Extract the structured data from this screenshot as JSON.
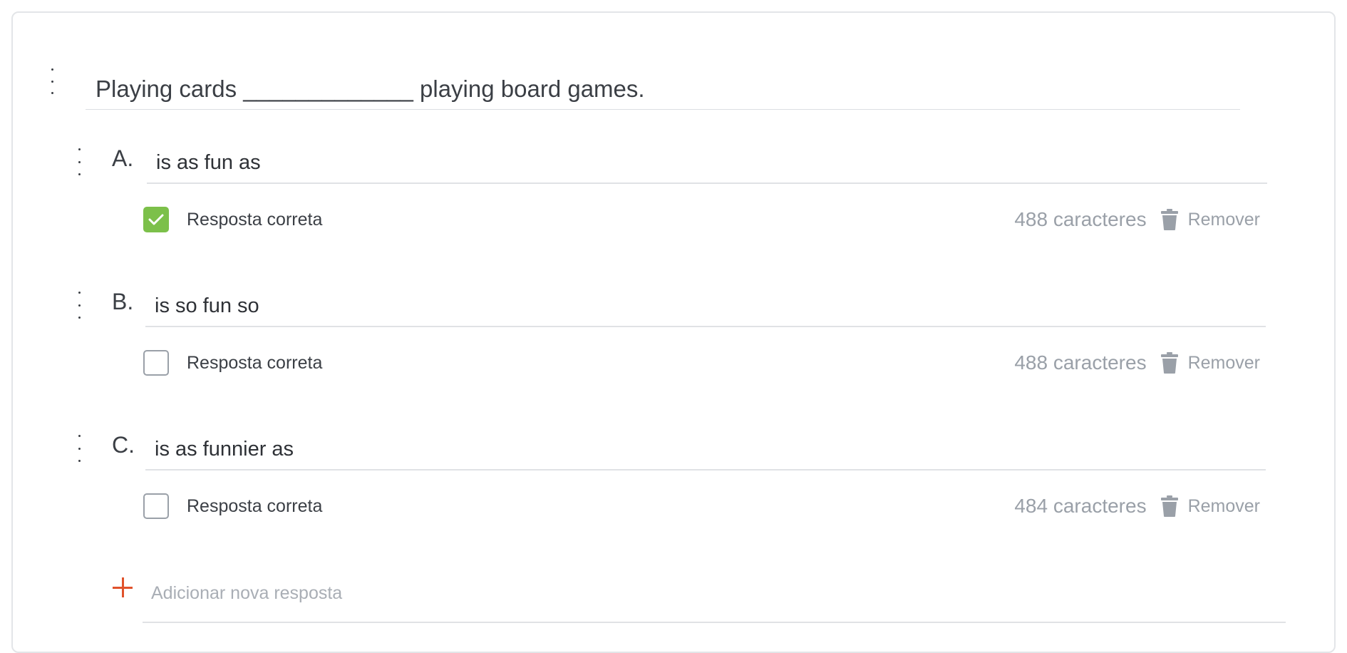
{
  "question": {
    "text": "Playing cards _____________ playing board games."
  },
  "answers": [
    {
      "letter": "A.",
      "text": "is as fun as",
      "correct": true,
      "correct_label": "Resposta correta",
      "char_count": "488 caracteres",
      "remove_label": "Remover"
    },
    {
      "letter": "B.",
      "text": "is so fun so",
      "correct": false,
      "correct_label": "Resposta correta",
      "char_count": "488 caracteres",
      "remove_label": "Remover"
    },
    {
      "letter": "C.",
      "text": "is as funnier as",
      "correct": false,
      "correct_label": "Resposta correta",
      "char_count": "484 caracteres",
      "remove_label": "Remover"
    }
  ],
  "add_answer": {
    "placeholder": "Adicionar nova resposta"
  },
  "colors": {
    "check_green": "#7cc04a",
    "add_orange": "#e0522b",
    "muted_gray": "#9aa0a8"
  },
  "icons": {
    "drag": "drag-handle-icon",
    "check": "checkmark-icon",
    "trash": "trash-icon",
    "add": "plus-icon"
  }
}
